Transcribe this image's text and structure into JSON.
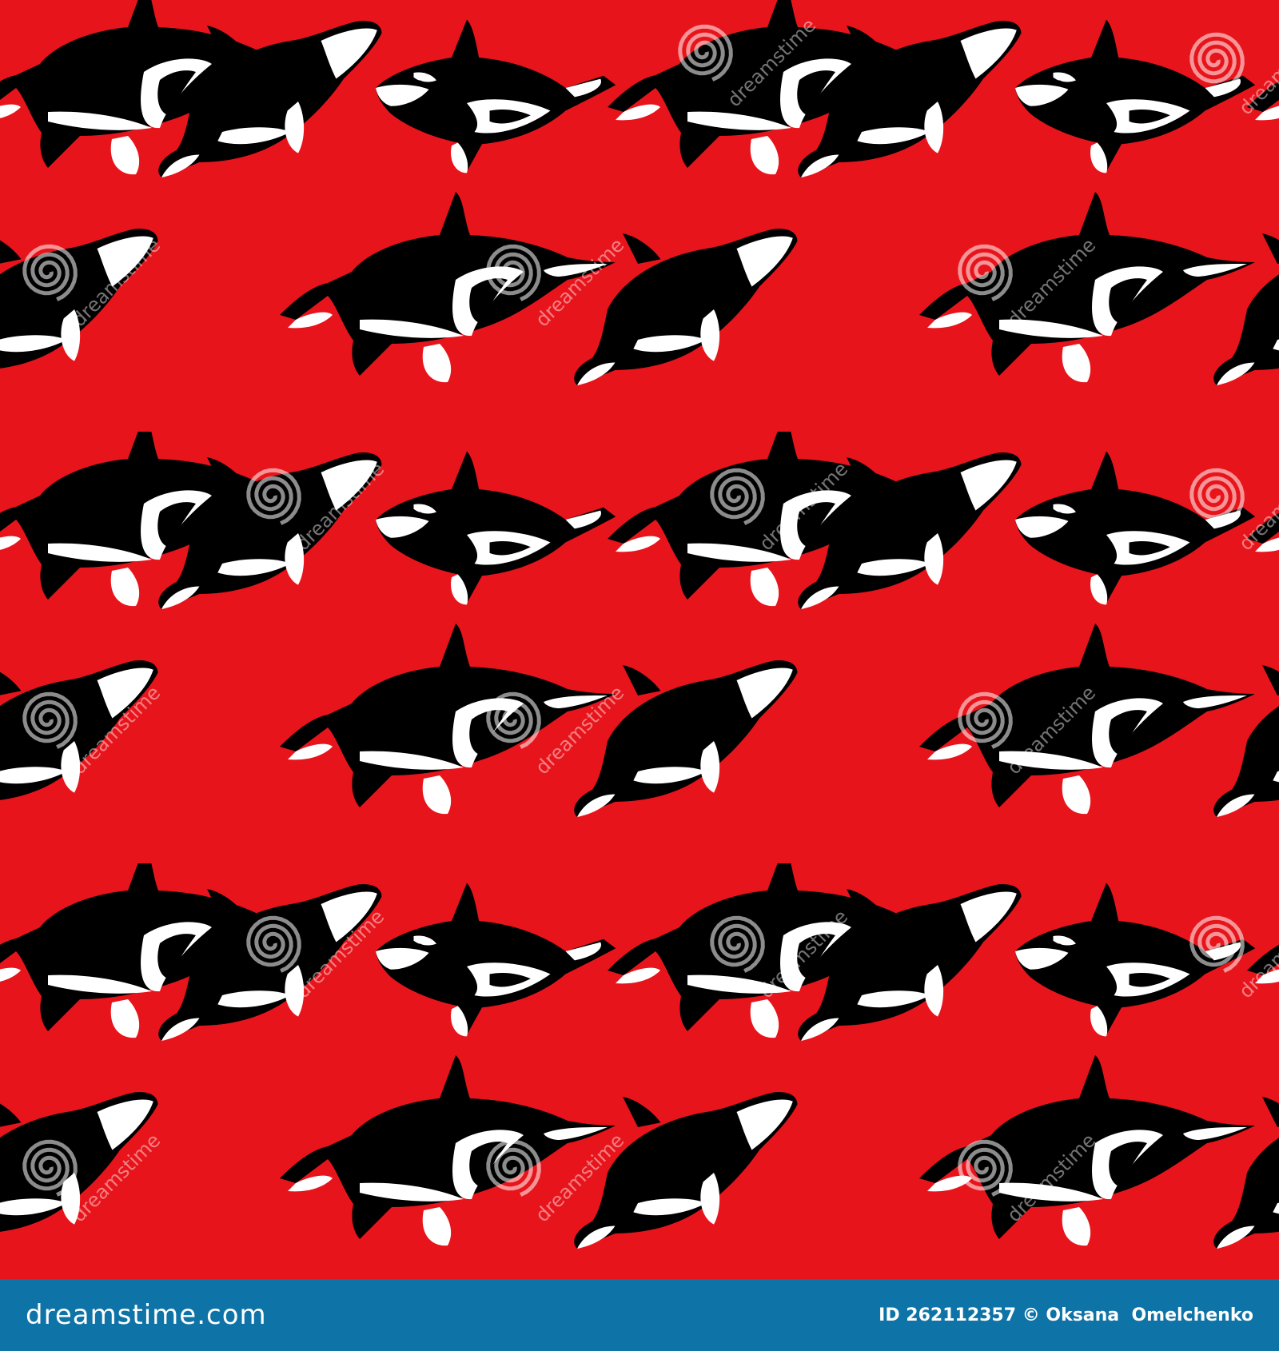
{
  "image": {
    "description_free": true,
    "colors": {
      "background": "#e8141b",
      "orca_black": "#000000",
      "orca_white": "#ffffff",
      "watermark": "#ffffff",
      "footer_bar": "#0e73a6"
    },
    "watermark_text": "dreamstime",
    "watermark_icon": "spiral-logo-icon"
  },
  "footer": {
    "brand": "dreamstime.com",
    "credit": "ID 262112357 © Oksana  Omelchenko"
  }
}
